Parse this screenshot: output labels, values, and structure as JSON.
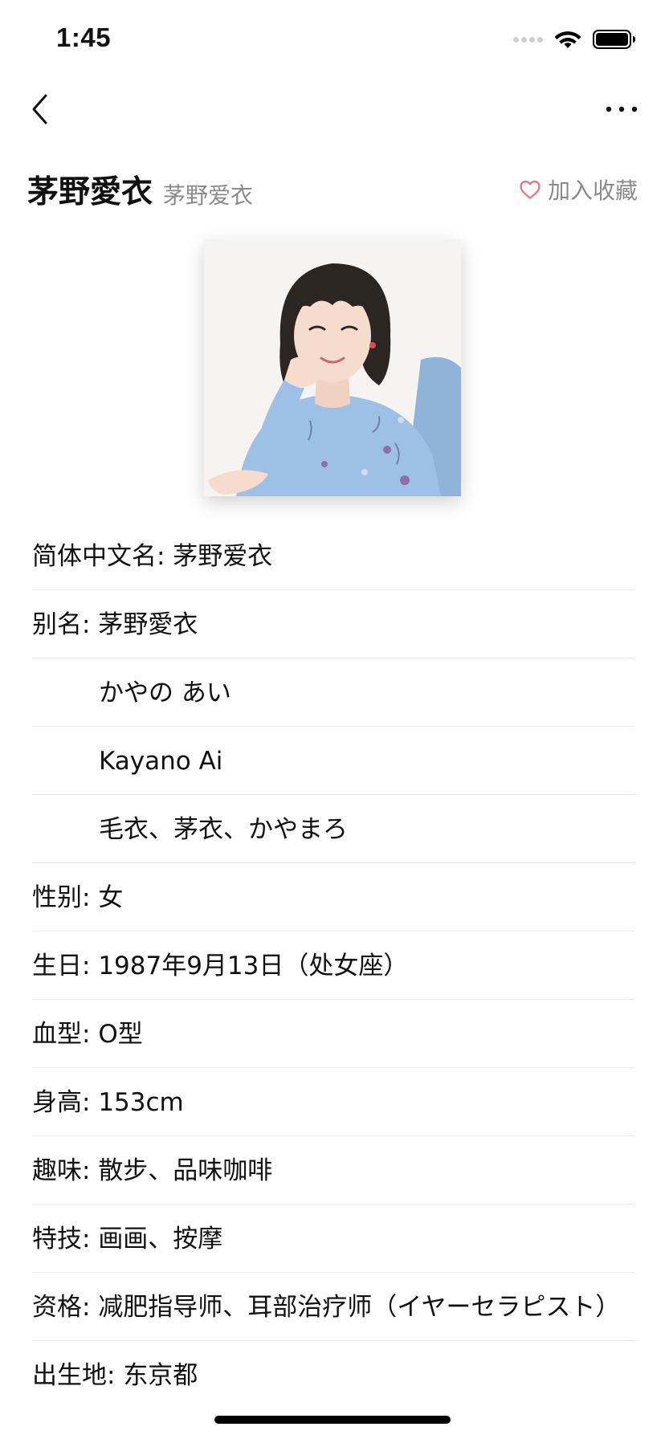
{
  "status_bar": {
    "time": "1:45"
  },
  "nav": {
    "back_icon": "chevron-left-icon",
    "more_icon": "ellipsis-icon"
  },
  "header": {
    "title": "茅野愛衣",
    "subtitle": "茅野爱衣",
    "favorite_label": "加入收藏",
    "favorite_icon": "heart-outline-icon",
    "favorite_color": "#f0707a"
  },
  "avatar": {
    "icon": "portrait-photo"
  },
  "info": {
    "chinese_name": {
      "label": "简体中文名",
      "value": "茅野爱衣"
    },
    "alias": {
      "label": "别名",
      "values": [
        "茅野愛衣",
        "かやの あい",
        "Kayano Ai",
        "毛衣、茅衣、かやまろ"
      ]
    },
    "gender": {
      "label": "性别",
      "value": "女"
    },
    "birthday": {
      "label": "生日",
      "value": "1987年9月13日（处女座）"
    },
    "blood_type": {
      "label": "血型",
      "value": "O型"
    },
    "height": {
      "label": "身高",
      "value": "153cm"
    },
    "hobby": {
      "label": "趣味",
      "value": "散步、品味咖啡"
    },
    "skill": {
      "label": "特技",
      "value": "画画、按摩"
    },
    "qualification": {
      "label": "资格",
      "value": "减肥指导师、耳部治疗师（イヤーセラピスト）"
    },
    "birthplace": {
      "label": "出生地",
      "value": "东京都"
    }
  }
}
